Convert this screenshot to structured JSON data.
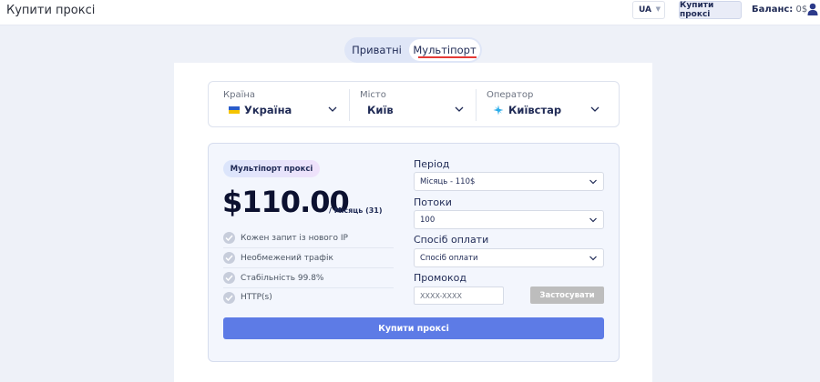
{
  "header": {
    "title": "Купити проксі",
    "language": "UA",
    "buy_button": "Купити проксі",
    "balance_label": "Баланс:",
    "balance_value": "0$"
  },
  "tabs": [
    {
      "label": "Приватні",
      "active": false
    },
    {
      "label": "Мультіпорт",
      "active": true
    }
  ],
  "selectors": {
    "country": {
      "label": "Країна",
      "value": "Україна",
      "icon": "ukraine-flag-icon"
    },
    "city": {
      "label": "Місто",
      "value": "Київ"
    },
    "operator": {
      "label": "Оператор",
      "value": "Київстар",
      "icon": "kyivstar-star-icon"
    }
  },
  "plan": {
    "badge": "Мультіпорт проксі",
    "price": "$110.00",
    "price_suffix": "/ Місяць (31)",
    "features": [
      "Кожен запит із нового IP",
      "Необмежений трафік",
      "Стабільність 99.8%",
      "HTTP(s)"
    ]
  },
  "form": {
    "period_label": "Період",
    "period_value": "Місяць - 110$",
    "threads_label": "Потоки",
    "threads_value": "100",
    "payment_label": "Спосіб оплати",
    "payment_value": "Спосіб оплати",
    "promo_label": "Промокод",
    "promo_placeholder": "XXXX-XXXX",
    "apply_button": "Застосувати",
    "buy_button": "Купити проксі"
  },
  "colors": {
    "primary": "#5d7be6",
    "disabled": "#bdbdbd",
    "accent_underline": "#e53935"
  }
}
